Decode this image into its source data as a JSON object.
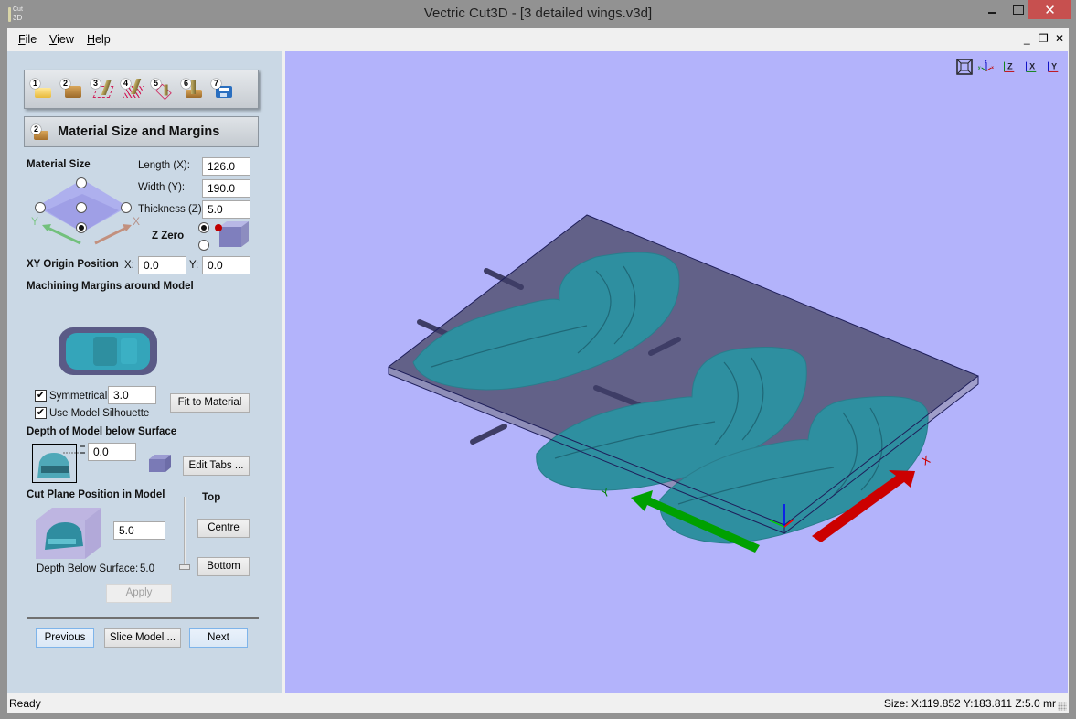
{
  "window": {
    "title": "Vectric Cut3D - [3 detailed wings.v3d]",
    "app_icon_line1": "Cut",
    "app_icon_line2": "3D",
    "close_glyph": "✕"
  },
  "menu": {
    "items": [
      {
        "label": "File",
        "accel": "F",
        "rest": "ile"
      },
      {
        "label": "View",
        "accel": "V",
        "rest": "iew"
      },
      {
        "label": "Help",
        "accel": "H",
        "rest": "elp"
      }
    ],
    "mdi_minimize": "_",
    "mdi_restore": "❐",
    "mdi_close": "✕"
  },
  "wizard": {
    "steps": [
      {
        "num": "1",
        "icon": "open-folder-icon"
      },
      {
        "num": "2",
        "icon": "material-block-icon"
      },
      {
        "num": "3",
        "icon": "roughing-toolpath-icon"
      },
      {
        "num": "4",
        "icon": "finishing-toolpath-icon"
      },
      {
        "num": "5",
        "icon": "cutout-toolpath-icon"
      },
      {
        "num": "6",
        "icon": "preview-toolpath-icon"
      },
      {
        "num": "7",
        "icon": "save-toolpath-icon"
      }
    ],
    "current_step_num": "2",
    "current_step_title": "Material Size and Margins"
  },
  "material": {
    "section_label": "Material Size",
    "length_label": "Length (X):",
    "length_value": "126.0",
    "width_label": "Width (Y):",
    "width_value": "190.0",
    "thickness_label": "Thickness (Z):",
    "thickness_value": "5.0",
    "axis_x": "X",
    "axis_y": "Y",
    "z_zero_label": "Z Zero",
    "z_zero_selected": "top",
    "xy_origin_selected": "bottom-corner"
  },
  "origin": {
    "label": "XY Origin Position",
    "x_label": "X:",
    "x_value": "0.0",
    "y_label": "Y:",
    "y_value": "0.0"
  },
  "margins": {
    "label": "Machining Margins around Model",
    "symmetrical_label": "Symmetrical",
    "symmetrical_checked": true,
    "symmetrical_value": "3.0",
    "use_silhouette_label": "Use Model Silhouette",
    "use_silhouette_checked": true,
    "fit_button": "Fit to Material",
    "check_glyph": "✔"
  },
  "depth": {
    "label": "Depth of Model below Surface",
    "value": "0.0",
    "edit_tabs_button": "Edit Tabs ..."
  },
  "cutplane": {
    "label": "Cut Plane Position in Model",
    "value": "5.0",
    "top_label": "Top",
    "centre_button": "Centre",
    "bottom_button": "Bottom",
    "depth_below_label": "Depth Below Surface:",
    "depth_below_value": "5.0",
    "slider_position": "bottom",
    "apply_button": "Apply"
  },
  "nav": {
    "previous": "Previous",
    "slice": "Slice Model ...",
    "next": "Next"
  },
  "viewport": {
    "view_buttons": [
      "zoom-extents",
      "iso-view",
      "view-z",
      "view-x",
      "view-y"
    ],
    "view_labels": {
      "z": "Z",
      "x": "X",
      "y": "Y"
    },
    "axis_label_x": "X",
    "axis_label_y": "Y",
    "colors": {
      "background": "#b3b3fb",
      "model": "#2e8fa0",
      "block": "#5b5a7e",
      "x_arrow": "#d00000",
      "y_arrow": "#00a000"
    }
  },
  "status": {
    "left": "Ready",
    "right": "Size: X:119.852 Y:183.811 Z:5.0 mr"
  }
}
